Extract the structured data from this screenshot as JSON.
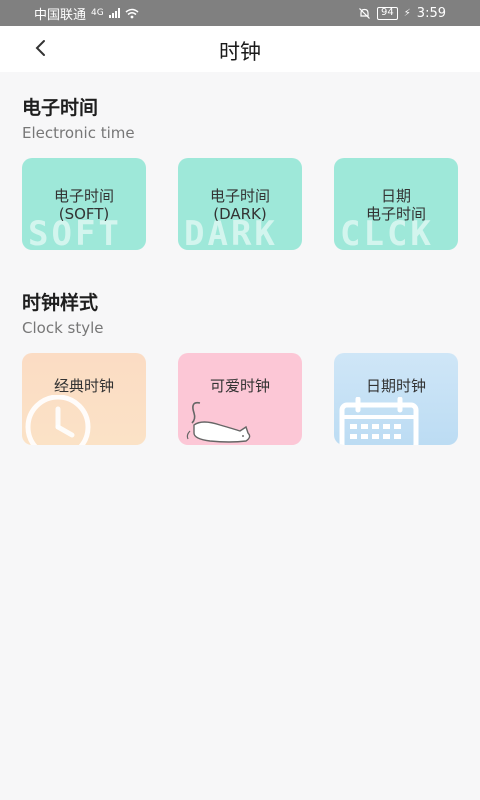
{
  "status_bar": {
    "carrier": "中国联通",
    "network": "4G",
    "battery": "94",
    "time": "3:59"
  },
  "header": {
    "title": "时钟"
  },
  "electronic": {
    "title": "电子时间",
    "subtitle": "Electronic time",
    "cards": [
      {
        "line1": "电子时间",
        "line2": "(SOFT)",
        "watermark": "SOFT"
      },
      {
        "line1": "电子时间",
        "line2": "(DARK)",
        "watermark": "DARK"
      },
      {
        "line1": "日期",
        "line2": "电子时间",
        "watermark": "CLCK"
      }
    ]
  },
  "clock_style": {
    "title": "时钟样式",
    "subtitle": "Clock style",
    "cards": [
      {
        "label": "经典时钟"
      },
      {
        "label": "可爱时钟"
      },
      {
        "label": "日期时钟"
      }
    ]
  },
  "colors": {
    "mint": "#9ee8d9",
    "peach": "#fbdcc4",
    "pink": "#fcc7d6",
    "blue": "#cfe6f7"
  }
}
